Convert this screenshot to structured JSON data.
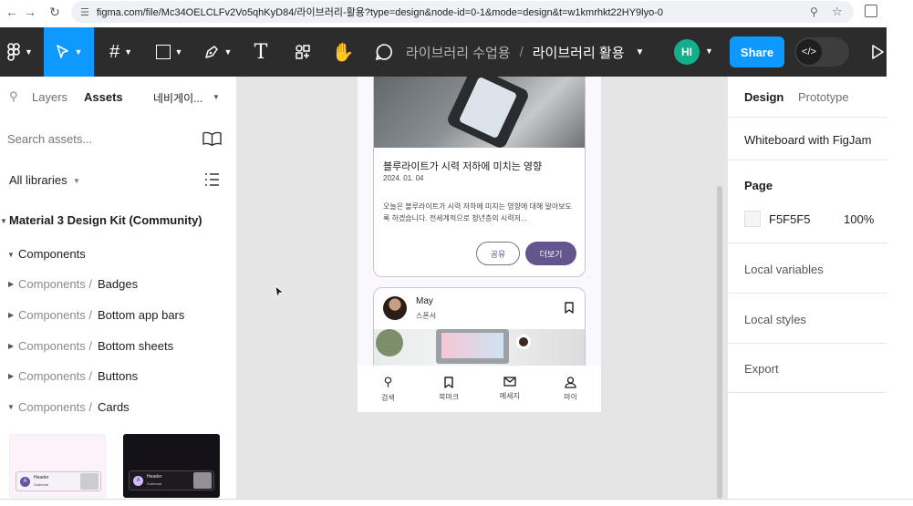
{
  "browser": {
    "url": "figma.com/file/Mc34OELCLFv2Vo5qhKyD84/라이브러리-활용?type=design&node-id=0-1&mode=design&t=w1kmrhkt22HY9lyo-0"
  },
  "toolbar": {
    "file_project": "라이브러리 수업용",
    "file_separator": "/",
    "file_name": "라이브러리 활용",
    "avatar_initials": "HI",
    "share_label": "Share"
  },
  "left_panel": {
    "tab_layers": "Layers",
    "tab_assets": "Assets",
    "page_dropdown": "네비게이...",
    "search_placeholder": "Search assets...",
    "libraries_label": "All libraries",
    "library_name": "Material 3 Design Kit (Community)",
    "components_label": "Components",
    "groups": [
      {
        "prefix": "Components / ",
        "name": "Badges"
      },
      {
        "prefix": "Components / ",
        "name": "Bottom app bars"
      },
      {
        "prefix": "Components / ",
        "name": "Bottom sheets"
      },
      {
        "prefix": "Components / ",
        "name": "Buttons"
      },
      {
        "prefix": "Components / ",
        "name": "Cards"
      }
    ],
    "thumbs": [
      {
        "header": "Header",
        "sub": "Subhead"
      },
      {
        "header": "Header",
        "sub": "Subhead"
      }
    ]
  },
  "canvas": {
    "card1": {
      "title": "블루라이트가 시력 저하에 미치는 영향",
      "date": "2024. 01. 04",
      "body": "오늘은 블루라이트가 시력 저하에 미치는 영향에 대해 알아보도록 하겠습니다. 전세계적으로 청년층의 시력저...",
      "btn_share": "공유",
      "btn_more": "더보기"
    },
    "card2": {
      "name": "May",
      "role": "스폰서"
    },
    "nav": [
      {
        "label": "검색",
        "icon": "search-icon"
      },
      {
        "label": "북마크",
        "icon": "bookmark-icon"
      },
      {
        "label": "메세지",
        "icon": "mail-icon"
      },
      {
        "label": "마이",
        "icon": "person-icon"
      }
    ]
  },
  "right_panel": {
    "tab_design": "Design",
    "tab_prototype": "Prototype",
    "whiteboard": "Whiteboard with FigJam",
    "page_heading": "Page",
    "page_color": "F5F5F5",
    "page_opacity": "100%",
    "local_variables": "Local variables",
    "local_styles": "Local styles",
    "export": "Export"
  },
  "colors": {
    "accent": "#0d99ff",
    "primary_purple": "#65558f",
    "toolbar_bg": "#2c2c2c",
    "canvas_bg": "#e5e5e5",
    "page_swatch": "#f5f5f5"
  }
}
